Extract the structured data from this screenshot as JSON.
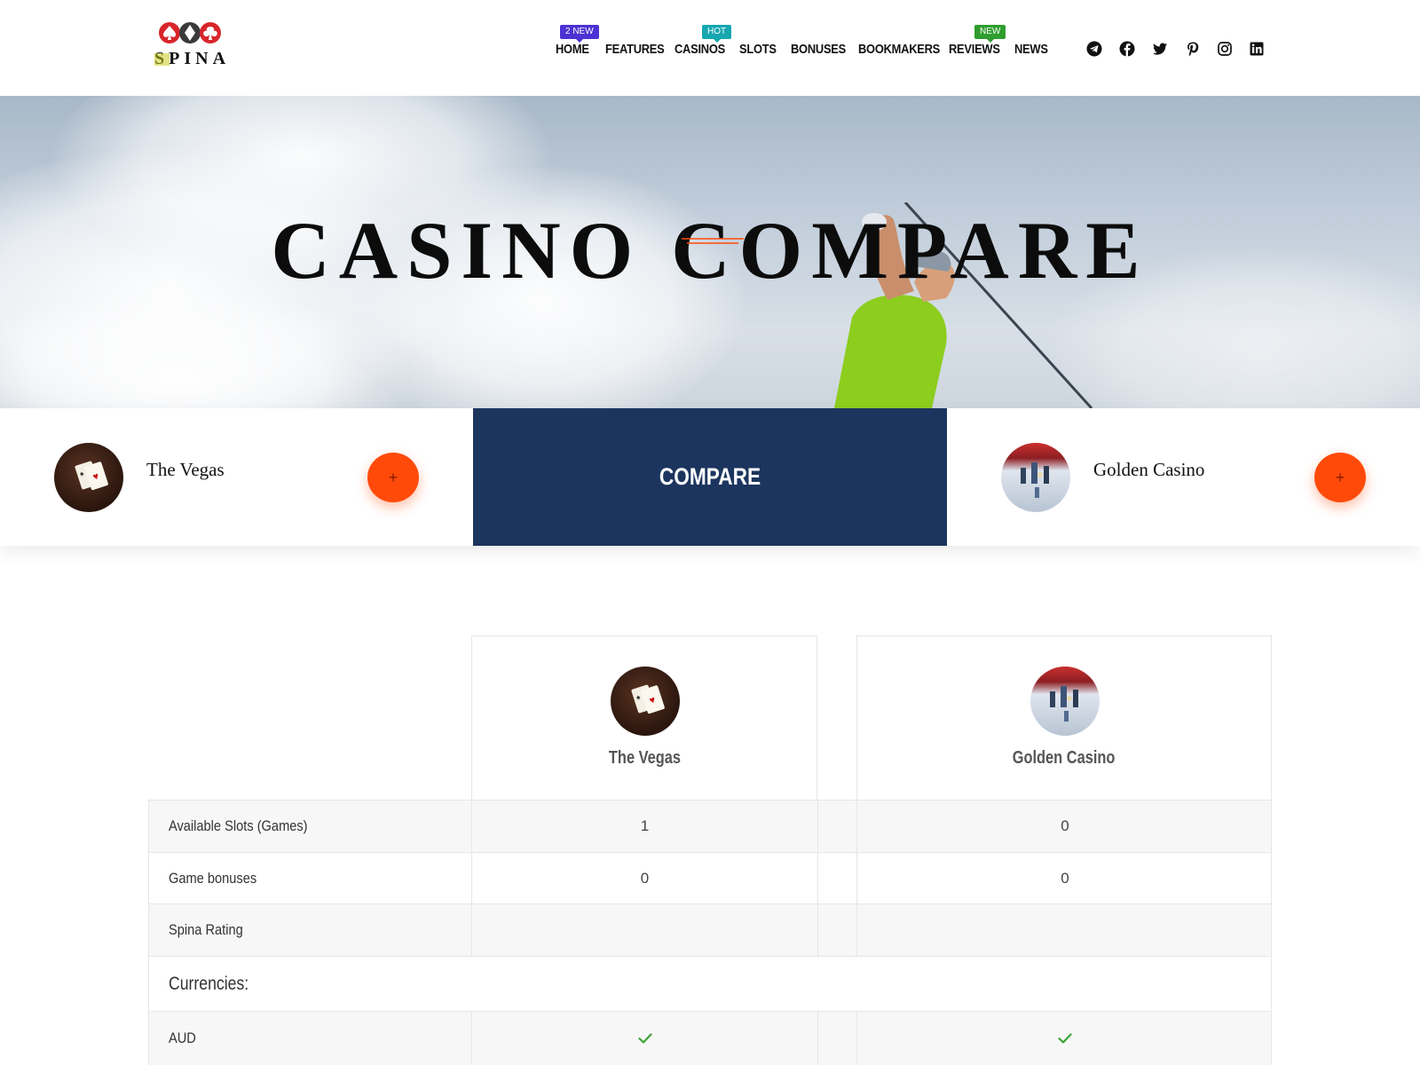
{
  "header": {
    "logo_text": "SPINA",
    "nav": [
      {
        "label": "HOME",
        "badge": "2 NEW",
        "badge_color": "#4b32d3"
      },
      {
        "label": "FEATURES"
      },
      {
        "label": "CASINOS",
        "badge": "HOT",
        "badge_color": "#16a7b0"
      },
      {
        "label": "SLOTS"
      },
      {
        "label": "BONUSES"
      },
      {
        "label": "BOOKMAKERS"
      },
      {
        "label": "REVIEWS",
        "badge": "NEW",
        "badge_color": "#2f9e2f"
      },
      {
        "label": "NEWS"
      }
    ],
    "socials": [
      "telegram-icon",
      "facebook-icon",
      "twitter-icon",
      "pinterest-icon",
      "instagram-icon",
      "linkedin-icon"
    ]
  },
  "hero": {
    "title": "CASINO COMPARE",
    "accent_color": "#ff4a0a"
  },
  "compare_bar": {
    "left_casino": "The Vegas",
    "center_label": "COMPARE",
    "right_casino": "Golden Casino",
    "plus_symbol": "+",
    "center_color": "#1c355e",
    "plus_color": "#ff4a0a"
  },
  "table": {
    "columns": [
      "The Vegas",
      "Golden Casino"
    ],
    "rows": [
      {
        "label": "Available Slots (Games)",
        "values": [
          "1",
          "0"
        ]
      },
      {
        "label": "Game bonuses",
        "values": [
          "0",
          "0"
        ]
      },
      {
        "label": "Spina Rating",
        "values": [
          "",
          ""
        ]
      }
    ],
    "section": "Currencies:",
    "currency_rows": [
      {
        "label": "AUD",
        "values": [
          "check-icon",
          "check-icon"
        ]
      }
    ],
    "check_color": "#3aa435"
  }
}
